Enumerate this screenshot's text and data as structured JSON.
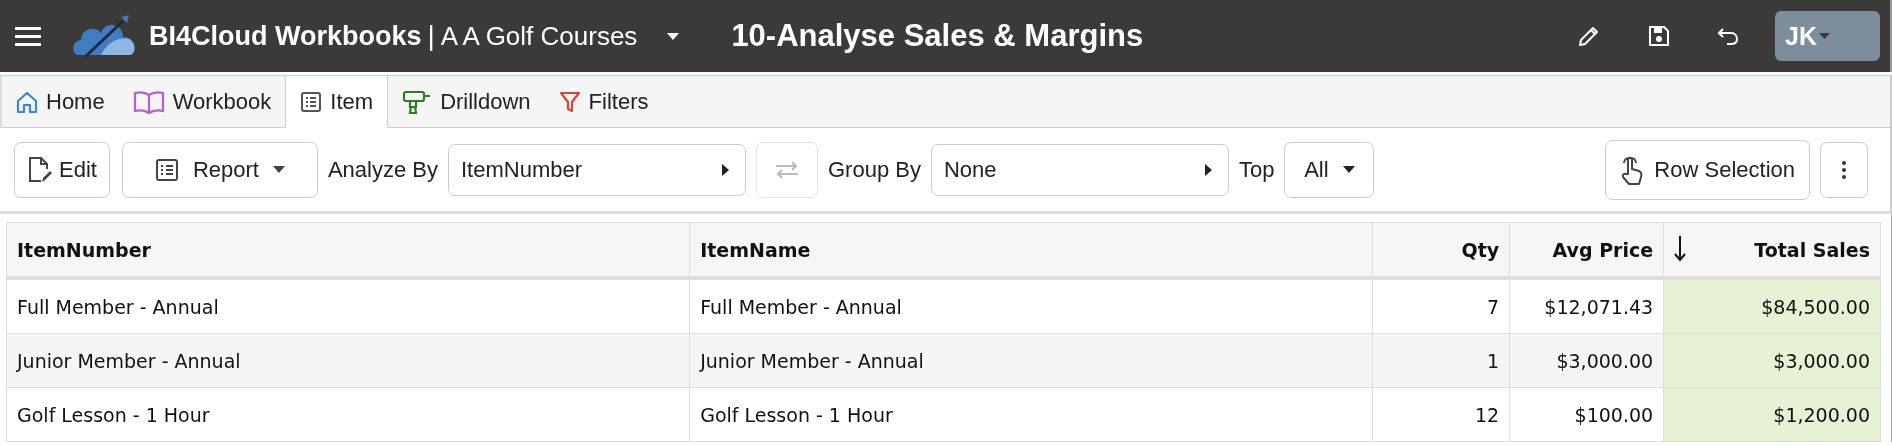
{
  "header": {
    "app_name": "BI4Cloud Workbooks",
    "separator": "|",
    "company": "A A Golf Courses",
    "title": "10-Analyse Sales & Margins",
    "user_initials": "JK"
  },
  "tabs": [
    {
      "label": "Home",
      "selected": false
    },
    {
      "label": "Workbook",
      "selected": false
    },
    {
      "label": "Item",
      "selected": true
    },
    {
      "label": "Drilldown",
      "selected": false
    },
    {
      "label": "Filters",
      "selected": false
    }
  ],
  "toolbar": {
    "edit_button": "Edit",
    "report_menu": "Report",
    "analyze_by": {
      "label": "Analyze By",
      "value": "ItemNumber"
    },
    "swap_button": {
      "disabled": true
    },
    "group_by": {
      "label": "Group By",
      "value": "None"
    },
    "top": {
      "label": "Top",
      "value": "All"
    },
    "row_selection_button": "Row Selection"
  },
  "table": {
    "columns": [
      {
        "label": "ItemNumber",
        "kind": "text",
        "sorted": false
      },
      {
        "label": "ItemName",
        "kind": "text",
        "sorted": false
      },
      {
        "label": "Qty",
        "kind": "number",
        "sorted": false
      },
      {
        "label": "Avg Price",
        "kind": "number",
        "sorted": false
      },
      {
        "label": "Total Sales",
        "kind": "number",
        "sorted": true
      }
    ],
    "rows": [
      [
        "Full Member - Annual",
        "Full Member - Annual",
        "7",
        "$12,071.43",
        "$84,500.00"
      ],
      [
        "Junior Member - Annual",
        "Junior Member - Annual",
        "1",
        "$3,000.00",
        "$3,000.00"
      ],
      [
        "Golf Lesson - 1 Hour",
        "Golf Lesson - 1 Hour",
        "12",
        "$100.00",
        "$1,200.00"
      ]
    ]
  }
}
